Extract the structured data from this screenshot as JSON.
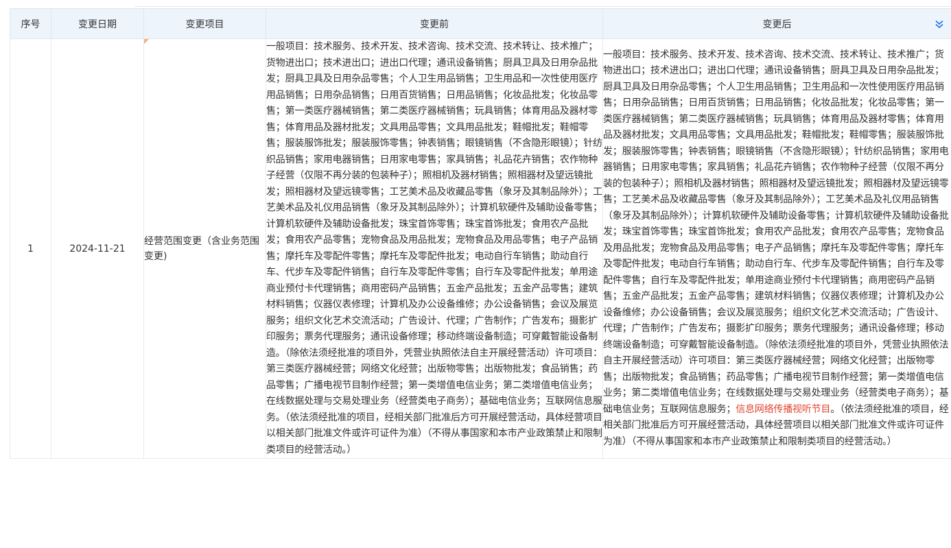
{
  "table": {
    "headers": {
      "index": "序号",
      "date": "变更日期",
      "item": "变更项目",
      "before": "变更前",
      "after": "变更后"
    },
    "rows": [
      {
        "index": "1",
        "date": "2024-11-21",
        "item": "经营范围变更（含业务范围变更)",
        "before": "一般项目：技术服务、技术开发、技术咨询、技术交流、技术转让、技术推广；货物进出口；技术进出口；进出口代理；通讯设备销售；厨具卫具及日用杂品批发；厨具卫具及日用杂品零售；个人卫生用品销售；卫生用品和一次性使用医疗用品销售；日用杂品销售；日用百货销售；日用品销售；化妆品批发；化妆品零售；第一类医疗器械销售；第二类医疗器械销售；玩具销售；体育用品及器材零售；体育用品及器材批发；文具用品零售；文具用品批发；鞋帽批发；鞋帽零售；服装服饰批发；服装服饰零售；钟表销售；眼镜销售（不含隐形眼镜）；针纺织品销售；家用电器销售；日用家电零售；家具销售；礼品花卉销售；农作物种子经营（仅限不再分装的包装种子）；照相机及器材销售；照相器材及望远镜批发；照相器材及望远镜零售；工艺美术品及收藏品零售（象牙及其制品除外）；工艺美术品及礼仪用品销售（象牙及其制品除外）；计算机软硬件及辅助设备零售；计算机软硬件及辅助设备批发；珠宝首饰零售；珠宝首饰批发；食用农产品批发；食用农产品零售；宠物食品及用品批发；宠物食品及用品零售；电子产品销售；摩托车及零配件零售；摩托车及零配件批发；电动自行车销售；助动自行车、代步车及零配件销售；自行车及零配件零售；自行车及零配件批发；单用途商业预付卡代理销售；商用密码产品销售；五金产品批发；五金产品零售；建筑材料销售；仪器仪表修理；计算机及办公设备维修；办公设备销售；会议及展览服务；组织文化艺术交流活动；广告设计、代理；广告制作；广告发布；摄影扩印服务；票务代理服务；通讯设备修理；移动终端设备制造；可穿戴智能设备制造。（除依法须经批准的项目外，凭营业执照依法自主开展经营活动）许可项目：第三类医疗器械经营；网络文化经营；出版物零售；出版物批发；食品销售；药品零售；广播电视节目制作经营；第一类增值电信业务；第二类增值电信业务；在线数据处理与交易处理业务（经营类电子商务）；基础电信业务；互联网信息服务。（依法须经批准的项目，经相关部门批准后方可开展经营活动，具体经营项目以相关部门批准文件或许可证件为准）（不得从事国家和本市产业政策禁止和限制类项目的经营活动。）",
        "after_part1": "一般项目：技术服务、技术开发、技术咨询、技术交流、技术转让、技术推广；货物进出口；技术进出口；进出口代理；通讯设备销售；厨具卫具及日用杂品批发；厨具卫具及日用杂品零售；个人卫生用品销售；卫生用品和一次性使用医疗用品销售；日用杂品销售；日用百货销售；日用品销售；化妆品批发；化妆品零售；第一类医疗器械销售；第二类医疗器械销售；玩具销售；体育用品及器材零售；体育用品及器材批发；文具用品零售；文具用品批发；鞋帽批发；鞋帽零售；服装服饰批发；服装服饰零售；钟表销售；眼镜销售（不含隐形眼镜）；针纺织品销售；家用电器销售；日用家电零售；家具销售；礼品花卉销售；农作物种子经营（仅限不再分装的包装种子）；照相机及器材销售；照相器材及望远镜批发；照相器材及望远镜零售；工艺美术品及收藏品零售（象牙及其制品除外）；工艺美术品及礼仪用品销售（象牙及其制品除外）；计算机软硬件及辅助设备零售；计算机软硬件及辅助设备批发；珠宝首饰零售；珠宝首饰批发；食用农产品批发；食用农产品零售；宠物食品及用品批发；宠物食品及用品零售；电子产品销售；摩托车及零配件零售；摩托车及零配件批发；电动自行车销售；助动自行车、代步车及零配件销售；自行车及零配件零售；自行车及零配件批发；单用途商业预付卡代理销售；商用密码产品销售；五金产品批发；五金产品零售；建筑材料销售；仪器仪表修理；计算机及办公设备维修；办公设备销售；会议及展览服务；组织文化艺术交流活动；广告设计、代理；广告制作；广告发布；摄影扩印服务；票务代理服务；通讯设备修理；移动终端设备制造；可穿戴智能设备制造。（除依法须经批准的项目外，凭营业执照依法自主开展经营活动）许可项目：第三类医疗器械经营；网络文化经营；出版物零售；出版物批发；食品销售；药品零售；广播电视节目制作经营；第一类增值电信业务；第二类增值电信业务；在线数据处理与交易处理业务（经营类电子商务）；基础电信业务；互联网信息服务；",
        "after_highlight": "信息网络传播视听节目",
        "after_part2": "。（依法须经批准的项目，经相关部门批准后方可开展经营活动，具体经营项目以相关部门批准文件或许可证件为准）（不得从事国家和本市产业政策禁止和限制类项目的经营活动。）"
      }
    ]
  },
  "colors": {
    "header_bg": "#eef4fc",
    "highlight": "#e0442f",
    "accent": "#1a73e8",
    "corner_flag": "#f3b27a"
  },
  "icons": {
    "collapse": "double-chevron-down-icon"
  }
}
